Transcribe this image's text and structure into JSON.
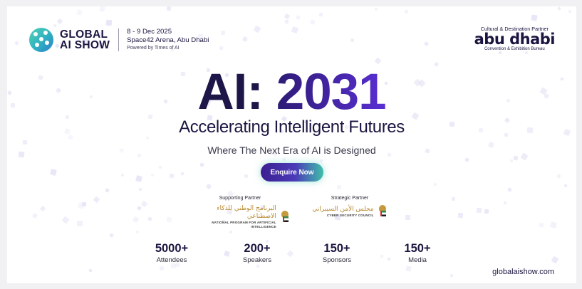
{
  "brand": {
    "logo_line1": "GLOBAL",
    "logo_line2": "AI SHOW",
    "logo_icon": "network-globe-icon"
  },
  "event": {
    "dates": "8 - 9 Dec 2025",
    "venue": "Space42 Arena, Abu Dhabi",
    "powered_by": "Powered by Times of AI"
  },
  "cultural_partner": {
    "role": "Cultural & Destination Partner",
    "name": "abu dhabi",
    "subtitle": "Convention & Exhibition Bureau"
  },
  "hero": {
    "title_prefix": "AI: ",
    "title_number": "2031",
    "subtitle": "Accelerating Intelligent Futures",
    "tagline": "Where The Next Era of AI is Designed",
    "cta_label": "Enquire Now"
  },
  "partners": [
    {
      "role": "Supporting Partner",
      "arabic": "البرنامج الوطني للذكاء الاصطناعي",
      "english": "NATIONAL PROGRAM FOR ARTIFICIAL INTELLIGENCE",
      "icon": "uae-emblem-icon"
    },
    {
      "role": "Strategic Partner",
      "arabic": "مجلس الأمن السيبراني",
      "english": "CYBER SECURITY COUNCIL",
      "icon": "uae-emblem-icon"
    }
  ],
  "stats": [
    {
      "value": "5000+",
      "label": "Attendees"
    },
    {
      "value": "200+",
      "label": "Speakers"
    },
    {
      "value": "150+",
      "label": "Sponsors"
    },
    {
      "value": "150+",
      "label": "Media"
    }
  ],
  "website": "globalaishow.com",
  "colors": {
    "navy": "#1d1648",
    "accent_purple": "#5a2fd4",
    "accent_teal": "#3fbfaa",
    "gold": "#b8892f"
  }
}
